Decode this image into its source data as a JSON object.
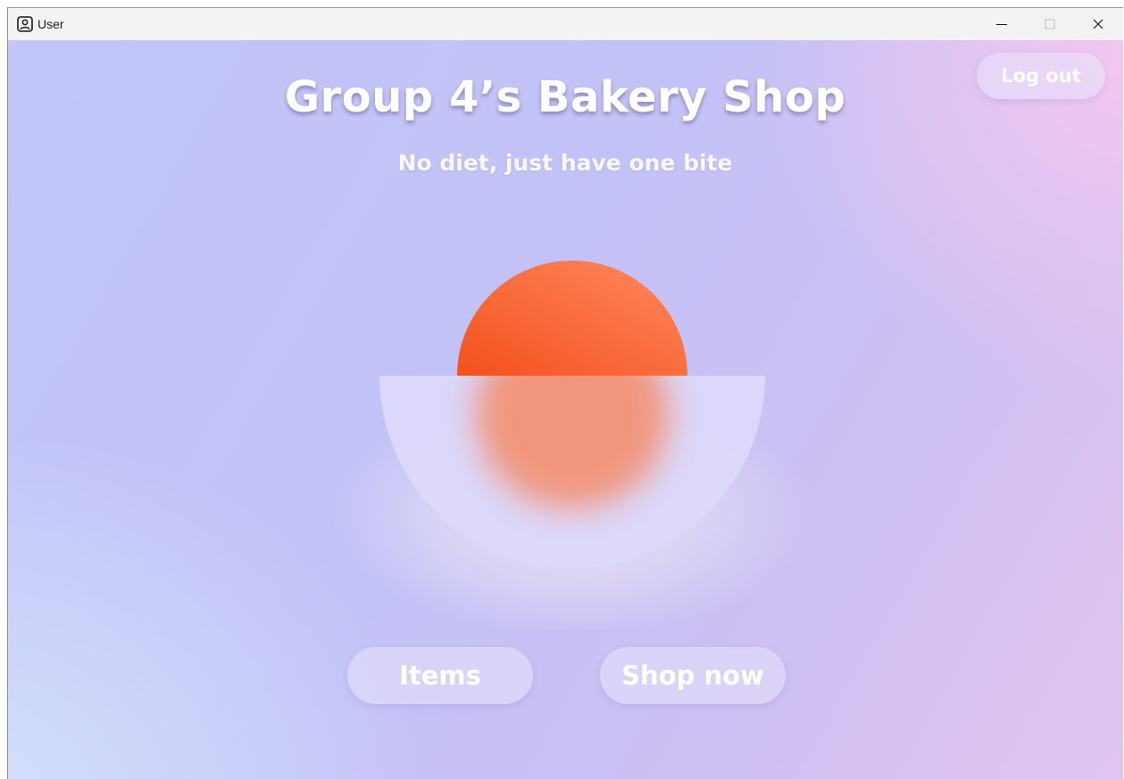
{
  "window": {
    "title": "User",
    "icon": "user-badge-icon",
    "controls": {
      "minimize_icon": "minimize-icon",
      "maximize_icon": "maximize-icon",
      "close_icon": "close-icon"
    }
  },
  "header": {
    "title": "Group 4’s Bakery Shop",
    "subtitle": "No diet, just have one bite",
    "logout_label": "Log out"
  },
  "hero": {
    "sun_color": "#f4521f",
    "bowl_color": "#dcd9fb"
  },
  "actions": {
    "items_label": "Items",
    "shop_label": "Shop now"
  }
}
